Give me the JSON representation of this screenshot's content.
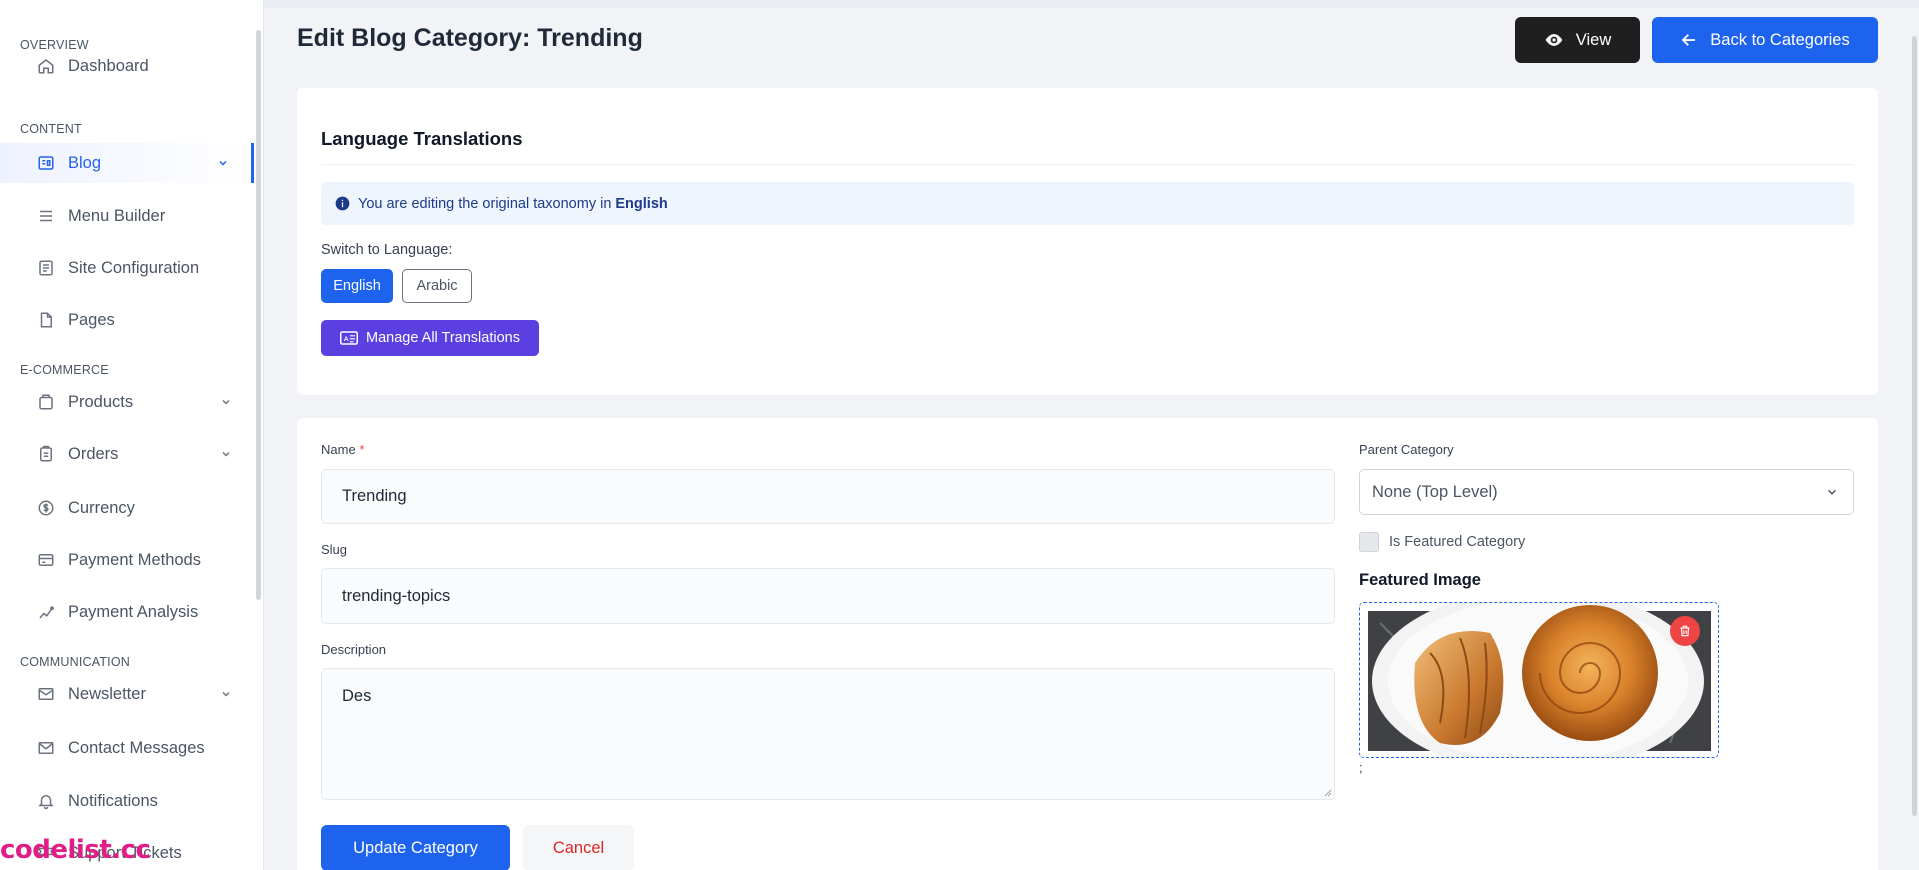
{
  "sidebar": {
    "sections": {
      "overview": "OVERVIEW",
      "content": "CONTENT",
      "ecommerce": "E-COMMERCE",
      "communication": "COMMUNICATION"
    },
    "items": [
      {
        "label": "Dashboard",
        "icon": "home-icon"
      },
      {
        "label": "Blog",
        "icon": "blog-icon",
        "active": true
      },
      {
        "label": "Menu Builder",
        "icon": "menu-icon"
      },
      {
        "label": "Site Configuration",
        "icon": "config-icon"
      },
      {
        "label": "Pages",
        "icon": "page-icon"
      },
      {
        "label": "Products",
        "icon": "box-icon"
      },
      {
        "label": "Orders",
        "icon": "clipboard-icon"
      },
      {
        "label": "Currency",
        "icon": "currency-icon"
      },
      {
        "label": "Payment Methods",
        "icon": "card-icon"
      },
      {
        "label": "Payment Analysis",
        "icon": "analysis-icon"
      },
      {
        "label": "Newsletter",
        "icon": "mail-icon"
      },
      {
        "label": "Contact Messages",
        "icon": "envelope-icon"
      },
      {
        "label": "Notifications",
        "icon": "bell-icon"
      },
      {
        "label": "Support Tickets",
        "icon": "ticket-icon"
      }
    ]
  },
  "header": {
    "title": "Edit Blog Category: Trending",
    "view_label": "View",
    "back_label": "Back to Categories"
  },
  "translations": {
    "title": "Language Translations",
    "info_prefix": "You are editing the original taxonomy in",
    "info_language": "English",
    "switch_label": "Switch to Language:",
    "languages": [
      "English",
      "Arabic"
    ],
    "manage_label": "Manage All Translations"
  },
  "form": {
    "name_label": "Name",
    "required_mark": "*",
    "name_value": "Trending",
    "slug_label": "Slug",
    "slug_value": "trending-topics",
    "description_label": "Description",
    "description_value": "Des",
    "parent_label": "Parent Category",
    "parent_value": "None (Top Level)",
    "featured_label": "Is Featured Category",
    "featured_checked": false,
    "image_title": "Featured Image",
    "image_caption": ";",
    "update_label": "Update Category",
    "cancel_label": "Cancel"
  },
  "watermark": "codelist.cc",
  "colors": {
    "primary": "#1d63ed",
    "dark": "#1f1f1f",
    "purple": "#5b3fe0",
    "danger": "#ef4444"
  }
}
